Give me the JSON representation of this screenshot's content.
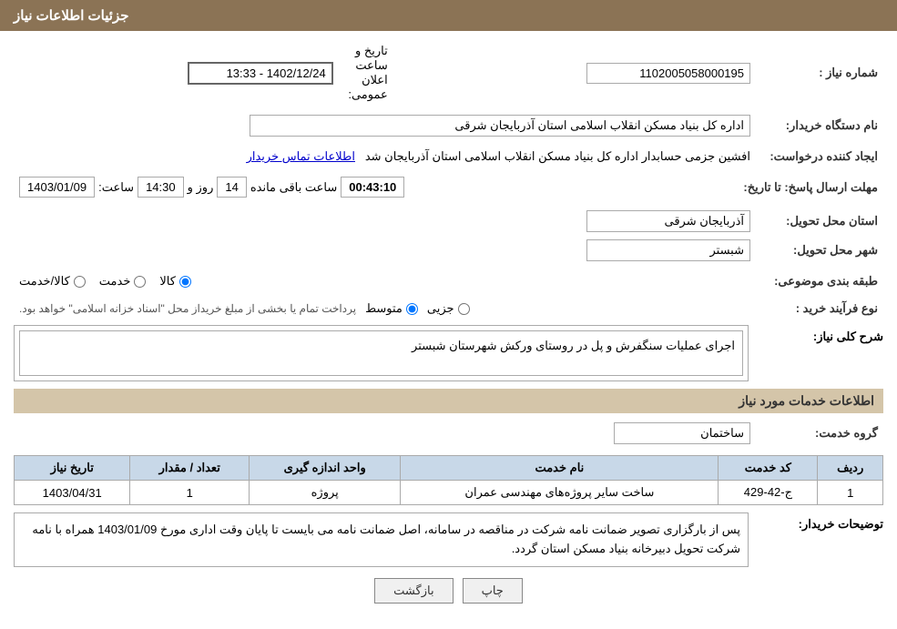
{
  "header": {
    "title": "جزئیات اطلاعات نیاز"
  },
  "fields": {
    "need_number_label": "شماره نیاز :",
    "need_number_value": "1102005058000195",
    "buyer_org_label": "نام دستگاه خریدار:",
    "buyer_org_value": "اداره کل بنیاد مسکن انقلاب اسلامی استان آذربایجان شرقی",
    "creator_label": "ایجاد کننده درخواست:",
    "creator_value": "افشین جزمی حسابدار اداره کل بنیاد مسکن انقلاب اسلامی استان آذربایجان شد",
    "creator_link": "اطلاعات تماس خریدار",
    "response_deadline_label": "مهلت ارسال پاسخ: تا تاریخ:",
    "date_value": "1403/01/09",
    "time_label": "ساعت:",
    "time_value": "14:30",
    "day_label": "روز و",
    "day_value": "14",
    "remaining_label": "ساعت باقی مانده",
    "remaining_value": "00:43:10",
    "announcement_date_label": "تاریخ و ساعت اعلان عمومی:",
    "announcement_date_value": "1402/12/24 - 13:33",
    "delivery_province_label": "استان محل تحویل:",
    "delivery_province_value": "آذربایجان شرقی",
    "delivery_city_label": "شهر محل تحویل:",
    "delivery_city_value": "شبستر",
    "subject_label": "طبقه بندی موضوعی:",
    "subject_options": [
      "کالا",
      "خدمت",
      "کالا/خدمت"
    ],
    "subject_selected": "کالا",
    "process_label": "نوع فرآیند خرید :",
    "process_options": [
      "جزیی",
      "متوسط"
    ],
    "process_selected": "متوسط",
    "process_note": "پرداخت تمام یا بخشی از مبلغ خریداز محل \"اسناد خزانه اسلامی\" خواهد بود.",
    "need_desc_label": "شرح کلی نیاز:",
    "need_desc_value": "اجرای عملیات سنگفرش و پل در روستای ورکش شهرستان شبستر",
    "services_info_label": "اطلاعات خدمات مورد نیاز",
    "service_group_label": "گروه خدمت:",
    "service_group_value": "ساختمان",
    "table_headers": {
      "row_num": "ردیف",
      "service_code": "کد خدمت",
      "service_name": "نام خدمت",
      "unit": "واحد اندازه گیری",
      "quantity": "تعداد / مقدار",
      "date": "تاریخ نیاز"
    },
    "table_rows": [
      {
        "row_num": "1",
        "service_code": "ج-42-429",
        "service_name": "ساخت سایر پروژه‌های مهندسی عمران",
        "unit": "پروژه",
        "quantity": "1",
        "date": "1403/04/31"
      }
    ],
    "buyer_notes_label": "توضیحات خریدار:",
    "buyer_notes_value": "پس از بارگزاری تصویر ضمانت نامه شرکت در مناقصه در سامانه، اصل ضمانت نامه می بایست تا پایان وقت اداری مورخ 1403/01/09 همراه با نامه شرکت تحویل دبیرخانه بنیاد مسکن استان گردد.",
    "btn_back": "بازگشت",
    "btn_print": "چاپ"
  }
}
